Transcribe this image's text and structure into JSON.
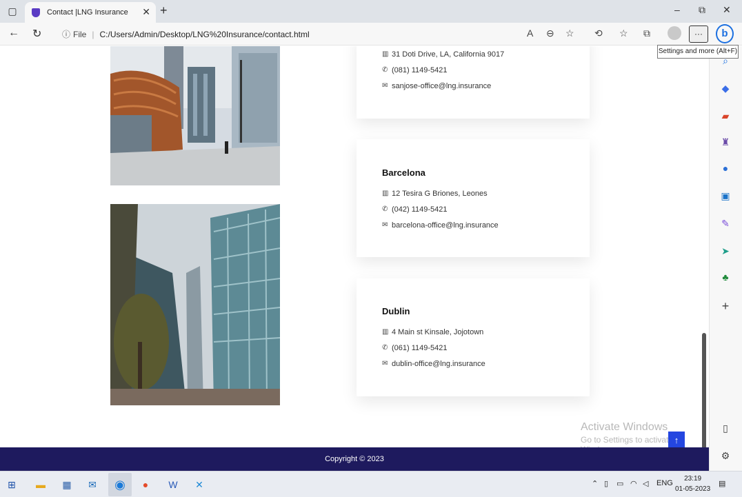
{
  "browser": {
    "tab_title": "Contact |LNG Insurance",
    "file_label": "File",
    "url": "C:/Users/Admin/Desktop/LNG%20Insurance/contact.html",
    "settings_tooltip": "Settings and more (Alt+F)"
  },
  "offices": [
    {
      "name": "",
      "address": "31 Doti Drive, LA, California 9017",
      "phone": "(081) 1149-5421",
      "email": "sanjose-office@lng.insurance"
    },
    {
      "name": "Barcelona",
      "address": "12 Tesira G Briones, Leones",
      "phone": "(042) 1149-5421",
      "email": "barcelona-office@lng.insurance"
    },
    {
      "name": "Dublin",
      "address": "4 Main st Kinsale, Jojotown",
      "phone": "(061) 1149-5421",
      "email": "dublin-office@lng.insurance"
    }
  ],
  "watermark": {
    "line1": "Activate Windows",
    "line2": "Go to Settings to activate Windows."
  },
  "footer": {
    "copyright": "Copyright © 2023"
  },
  "taskbar": {
    "language": "ENG",
    "time": "23:19",
    "date": "01-05-2023"
  },
  "colors": {
    "footer_bg": "#1e1a5e",
    "to_top_button": "#2446e0"
  }
}
